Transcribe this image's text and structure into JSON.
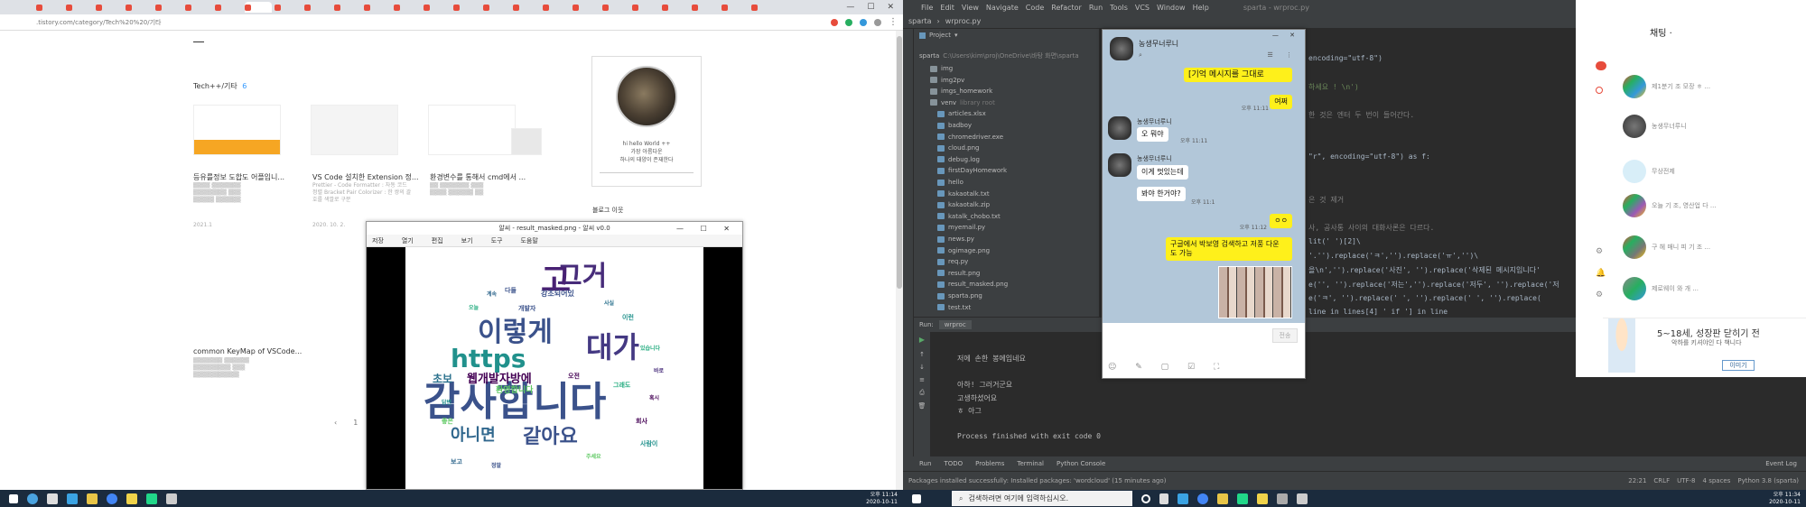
{
  "browser": {
    "tabs": [
      {
        "label": "",
        "color": "#e74c3c"
      },
      {
        "label": "",
        "color": "#e74c3c"
      },
      {
        "label": "",
        "color": "#e74c3c"
      },
      {
        "label": "",
        "color": "#e74c3c"
      },
      {
        "label": "",
        "color": "#e74c3c"
      },
      {
        "label": "",
        "color": "#e74c3c"
      },
      {
        "label": "",
        "color": "#e74c3c"
      },
      {
        "label": "",
        "color": "#e74c3c"
      },
      {
        "label": "",
        "color": "#e74c3c"
      },
      {
        "label": "",
        "color": "#e74c3c"
      },
      {
        "label": "",
        "color": "#e74c3c"
      },
      {
        "label": "",
        "color": "#e74c3c"
      },
      {
        "label": "",
        "color": "#e74c3c"
      },
      {
        "label": "",
        "color": "#e74c3c"
      },
      {
        "label": "",
        "color": "#e74c3c"
      },
      {
        "label": "",
        "color": "#e74c3c"
      },
      {
        "label": "",
        "color": "#e74c3c"
      },
      {
        "label": "",
        "color": "#e74c3c"
      },
      {
        "label": "",
        "color": "#e74c3c"
      },
      {
        "label": "",
        "color": "#e74c3c"
      },
      {
        "label": "",
        "color": "#e74c3c"
      },
      {
        "label": "",
        "color": "#e74c3c"
      },
      {
        "label": "",
        "color": "#e74c3c"
      },
      {
        "label": "",
        "color": "#e74c3c"
      },
      {
        "label": "",
        "color": "#e74c3c"
      }
    ],
    "url": ".tistory.com/category/Tech%20%20/기타",
    "category_title": "Tech++/기타",
    "category_count": "6",
    "posts": [
      {
        "title": "등유를정보 도합도 어플입니...",
        "desc": "",
        "date": "2021.1"
      },
      {
        "title": "VS Code 설치한 Extension 정...",
        "desc": "Prettier - Code Formatter : 자동 코드 정렬 Bracket Pair Colorizer : 한 쌍의 괄호를 색깔로 구분",
        "date": "2020. 10. 2."
      },
      {
        "title": "환경변수를 통해서 cmd에서 ...",
        "desc": "",
        "date": ""
      }
    ],
    "post4_title": "common KeyMap of VSCode...",
    "post4_desc": "",
    "profile_line1": "hi hello World ++",
    "profile_line2": "가장 아름다운",
    "profile_line3": "하나의 태양이 존재한다",
    "sidebar_heading": "블로그 이웃",
    "pager": [
      "‹",
      "1"
    ]
  },
  "viewer": {
    "title": "알씨 - result_masked.png - 알씨 v0.0",
    "toolbar": [
      "저장",
      "열기",
      "편집",
      "보기",
      "도구",
      "도움말"
    ],
    "cloud_words": [
      {
        "t": "감사합니다",
        "s": 44,
        "c": "#3b528b"
      },
      {
        "t": "그거",
        "s": 30,
        "c": "#472c7a"
      },
      {
        "t": "이렇게",
        "s": 30,
        "c": "#3b528b"
      },
      {
        "t": "https",
        "s": 28,
        "c": "#21918c"
      },
      {
        "t": "대가",
        "s": 32,
        "c": "#443983"
      },
      {
        "t": "고",
        "s": 36,
        "c": "#482173"
      },
      {
        "t": "같아요",
        "s": 22,
        "c": "#3b528b"
      },
      {
        "t": "아니면",
        "s": 18,
        "c": "#31688e"
      },
      {
        "t": "웹개발자방에",
        "s": 13,
        "c": "#440154"
      },
      {
        "t": "초보",
        "s": 12,
        "c": "#2c728e"
      },
      {
        "t": "환영합니다",
        "s": 9,
        "c": "#5ec962"
      },
      {
        "t": "강조되어있",
        "s": 8,
        "c": "#3b528b"
      },
      {
        "t": "사람이",
        "s": 7,
        "c": "#21918c"
      },
      {
        "t": "회사",
        "s": 7,
        "c": "#440154"
      },
      {
        "t": "그래도",
        "s": 7,
        "c": "#27ad81"
      },
      {
        "t": "개발자",
        "s": 7,
        "c": "#3b528b"
      },
      {
        "t": "보고",
        "s": 7,
        "c": "#31688e"
      },
      {
        "t": "좋은",
        "s": 7,
        "c": "#5ec962"
      },
      {
        "t": "이런",
        "s": 7,
        "c": "#21918c"
      },
      {
        "t": "오전",
        "s": 7,
        "c": "#440154"
      },
      {
        "t": "다들",
        "s": 7,
        "c": "#3b528b"
      },
      {
        "t": "계속",
        "s": 6,
        "c": "#31688e"
      },
      {
        "t": "있습니다",
        "s": 6,
        "c": "#27ad81"
      },
      {
        "t": "바로",
        "s": 6,
        "c": "#472c7a"
      },
      {
        "t": "사실",
        "s": 6,
        "c": "#2c728e"
      },
      {
        "t": "답변",
        "s": 6,
        "c": "#21918c"
      },
      {
        "t": "주세요",
        "s": 6,
        "c": "#5ec962"
      },
      {
        "t": "정말",
        "s": 6,
        "c": "#3b528b"
      },
      {
        "t": "혹시",
        "s": 6,
        "c": "#440154"
      },
      {
        "t": "오늘",
        "s": 6,
        "c": "#27ad81"
      }
    ]
  },
  "pycharm": {
    "menu": [
      "File",
      "Edit",
      "View",
      "Navigate",
      "Code",
      "Refactor",
      "Run",
      "Tools",
      "VCS",
      "Window",
      "Help"
    ],
    "window_title": "sparta - wrproc.py",
    "crumb": [
      "sparta",
      "wrproc.py"
    ],
    "project_label": "Project",
    "root": "sparta",
    "root_path": "C:\\Users\\kim\\proj\\OneDrive\\바탕 화면\\sparta",
    "tree": [
      {
        "name": "img",
        "kind": "folder"
      },
      {
        "name": "img2pv",
        "kind": "folder"
      },
      {
        "name": "imgs_homework",
        "kind": "folder"
      },
      {
        "name": "venv",
        "kind": "folder",
        "note": "library root"
      },
      {
        "name": "articles.xlsx",
        "kind": "file"
      },
      {
        "name": "badboy",
        "kind": "file"
      },
      {
        "name": "chromedriver.exe",
        "kind": "file"
      },
      {
        "name": "cloud.png",
        "kind": "file"
      },
      {
        "name": "debug.log",
        "kind": "file"
      },
      {
        "name": "firstDayHomework",
        "kind": "file"
      },
      {
        "name": "hello",
        "kind": "file"
      },
      {
        "name": "kakaotalk.txt",
        "kind": "file"
      },
      {
        "name": "kakaotalk.zip",
        "kind": "file"
      },
      {
        "name": "katalk_chobo.txt",
        "kind": "file"
      },
      {
        "name": "myemail.py",
        "kind": "file"
      },
      {
        "name": "news.py",
        "kind": "file"
      },
      {
        "name": "ogimage.png",
        "kind": "file"
      },
      {
        "name": "req.py",
        "kind": "file"
      },
      {
        "name": "result.png",
        "kind": "file"
      },
      {
        "name": "result_masked.png",
        "kind": "file"
      },
      {
        "name": "sparta.png",
        "kind": "file"
      },
      {
        "name": "test.txt",
        "kind": "file"
      }
    ],
    "code": [
      {
        "t": "encoding=\"utf-8\")",
        "c": "#a9b7c6"
      },
      {
        "t": "",
        "c": "#a9b7c6"
      },
      {
        "t": "하세요 ! \\n')",
        "c": "#6a8759"
      },
      {
        "t": "",
        "c": "#a9b7c6"
      },
      {
        "t": "한 것은 엔터 두 번이 들어간다.",
        "c": "#808080"
      },
      {
        "t": "",
        "c": "#a9b7c6"
      },
      {
        "t": "",
        "c": "#a9b7c6"
      },
      {
        "t": "\"r\", encoding=\"utf-8\") as f:",
        "c": "#a9b7c6"
      },
      {
        "t": "",
        "c": "#a9b7c6"
      },
      {
        "t": "",
        "c": "#a9b7c6"
      },
      {
        "t": "은 것 제거",
        "c": "#808080"
      },
      {
        "t": "",
        "c": "#a9b7c6"
      },
      {
        "t": "사, 공사통 사이의 대화사론은 다르다.",
        "c": "#808080"
      },
      {
        "t": "lit(' ')[2]\\",
        "c": "#a9b7c6"
      },
      {
        "t": "'.'').replace('ㅋ','').replace('ㅠ','')\\",
        "c": "#a9b7c6"
      },
      {
        "t": "을\\n','').replace('사진', '').replace('삭제된 메시지입니다'",
        "c": "#a9b7c6"
      },
      {
        "t": "e('', '').replace('저는','').replace('저두', '').replace('저",
        "c": "#a9b7c6"
      },
      {
        "t": "e('ㅋ', '').replace('    ', '').replace('    ', '').replace(",
        "c": "#a9b7c6"
      },
      {
        "t": "line in lines[4] ' if '] in line",
        "c": "#a9b7c6"
      }
    ],
    "run_tab_label": "Run:",
    "run_file": "wrproc",
    "output": [
      "저에 손한 봉에입네요",
      "",
      "아하! 그러거군요",
      "고생하셨어요",
      "ㅎ 아그",
      "",
      "Process finished with exit code 0"
    ],
    "bottom_tabs": [
      "Run",
      "TODO",
      "Problems",
      "Terminal",
      "Python Console",
      "Event Log"
    ],
    "status_msg": "Packages installed successfully: Installed packages: 'wordcloud' (15 minutes ago)",
    "status_right": [
      "22:21",
      "CRLF",
      "UTF-8",
      "4 spaces",
      "Python 3.8 (sparta)"
    ]
  },
  "kakao": {
    "room": "농생무너루니",
    "msgs": [
      {
        "side": "me",
        "text": "[기억 메시지를 그대로",
        "time": ""
      },
      {
        "side": "me",
        "text": "여쩌",
        "time": "오후 11:11"
      },
      {
        "side": "you",
        "name": "농생무너루니",
        "text": "오 뭐야",
        "time": "오후 11:11"
      },
      {
        "side": "you",
        "name": "농생무너루니",
        "text": "이게 멋있는데",
        "time": ""
      },
      {
        "side": "you",
        "name": "",
        "text": "봐야 한거야?",
        "time": "오후 11:1"
      },
      {
        "side": "me",
        "text": "ㅇㅇ",
        "time": "오후 11:12"
      },
      {
        "side": "me",
        "text": "구글에서 박보영 검색하고 저풍 다운 도 가능",
        "time": ""
      }
    ],
    "send_label": "전송"
  },
  "chatpanel": {
    "title": "채팅",
    "dot": "·",
    "banner": "5~18세, 성장판 닫히기 전",
    "banner_sub": "악하를 키셔야인 다 책니다",
    "items": [
      "제1분기 조 모장 ㅎ ...",
      "농생무너루니",
      "무상전제",
      "오늘 기 조, 영산업 다 ...",
      "구 헤 매니 피 기 조 ...",
      "제로웨이 와 개 ..."
    ]
  },
  "taskbar": {
    "search_placeholder": "검색하려면 여기에 입력하십시오.",
    "time_left": "오후 11:14",
    "date_left": "2020-10-11",
    "time_right": "오후 11:34",
    "date_right": "2020-10-11"
  }
}
